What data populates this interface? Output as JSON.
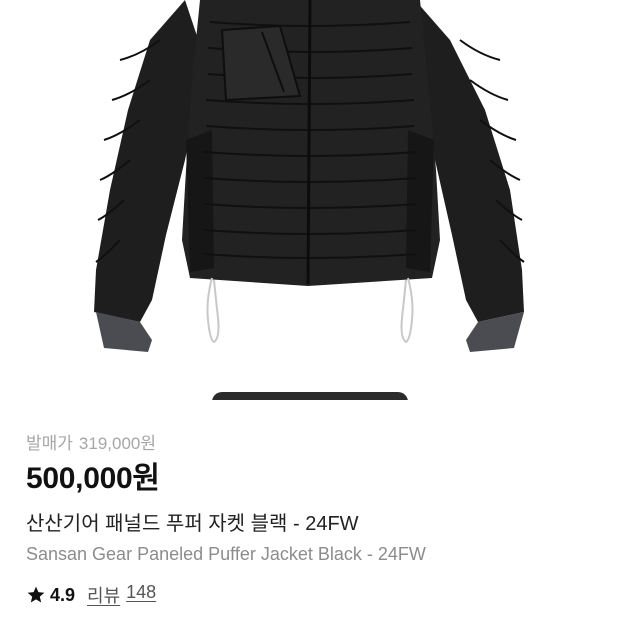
{
  "product": {
    "image_alt": "산산기어 패널드 푸퍼 자켓 블랙 - 24FW",
    "release_price_label": "발매가",
    "release_price": "319,000원",
    "price": "500,000원",
    "name_ko": "산산기어 패널드 푸퍼 자켓 블랙 - 24FW",
    "name_en": "Sansan Gear Paneled Puffer Jacket Black - 24FW",
    "rating": "4.9",
    "review_label": "리뷰",
    "review_count": "148"
  },
  "icons": {
    "rating": "star-icon"
  },
  "colors": {
    "jacket": "#1e1e1e",
    "cuff": "#4a4c52",
    "price_text": "#111111",
    "muted_text": "#a6a6a6",
    "carousel_indicator": "#2b2b2b"
  }
}
